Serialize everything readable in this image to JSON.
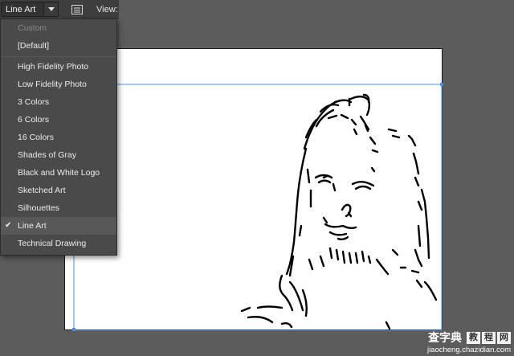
{
  "toolbar": {
    "preset_value": "Line Art",
    "view_label": "View:"
  },
  "menu": {
    "items": [
      {
        "label": "Custom",
        "disabled": true
      },
      {
        "label": "[Default]"
      },
      {
        "label": "High Fidelity Photo"
      },
      {
        "label": "Low Fidelity Photo"
      },
      {
        "label": "3 Colors"
      },
      {
        "label": "6 Colors"
      },
      {
        "label": "16 Colors"
      },
      {
        "label": "Shades of Gray"
      },
      {
        "label": "Black and White Logo"
      },
      {
        "label": "Sketched Art"
      },
      {
        "label": "Silhouettes"
      },
      {
        "label": "Line Art",
        "checked": true
      },
      {
        "label": "Technical Drawing"
      }
    ]
  },
  "canvas": {
    "selection_color": "#4a90e2",
    "trace_color": "#000000"
  },
  "watermark": {
    "brand": "查字典",
    "boxes": [
      "教",
      "程",
      "网"
    ],
    "url": "jiaocheng.chazidian.com"
  },
  "icons": {
    "dropdown_arrow": "triangle-down-icon",
    "panel_button": "panel-list-icon",
    "checkmark": "checkmark-icon"
  }
}
